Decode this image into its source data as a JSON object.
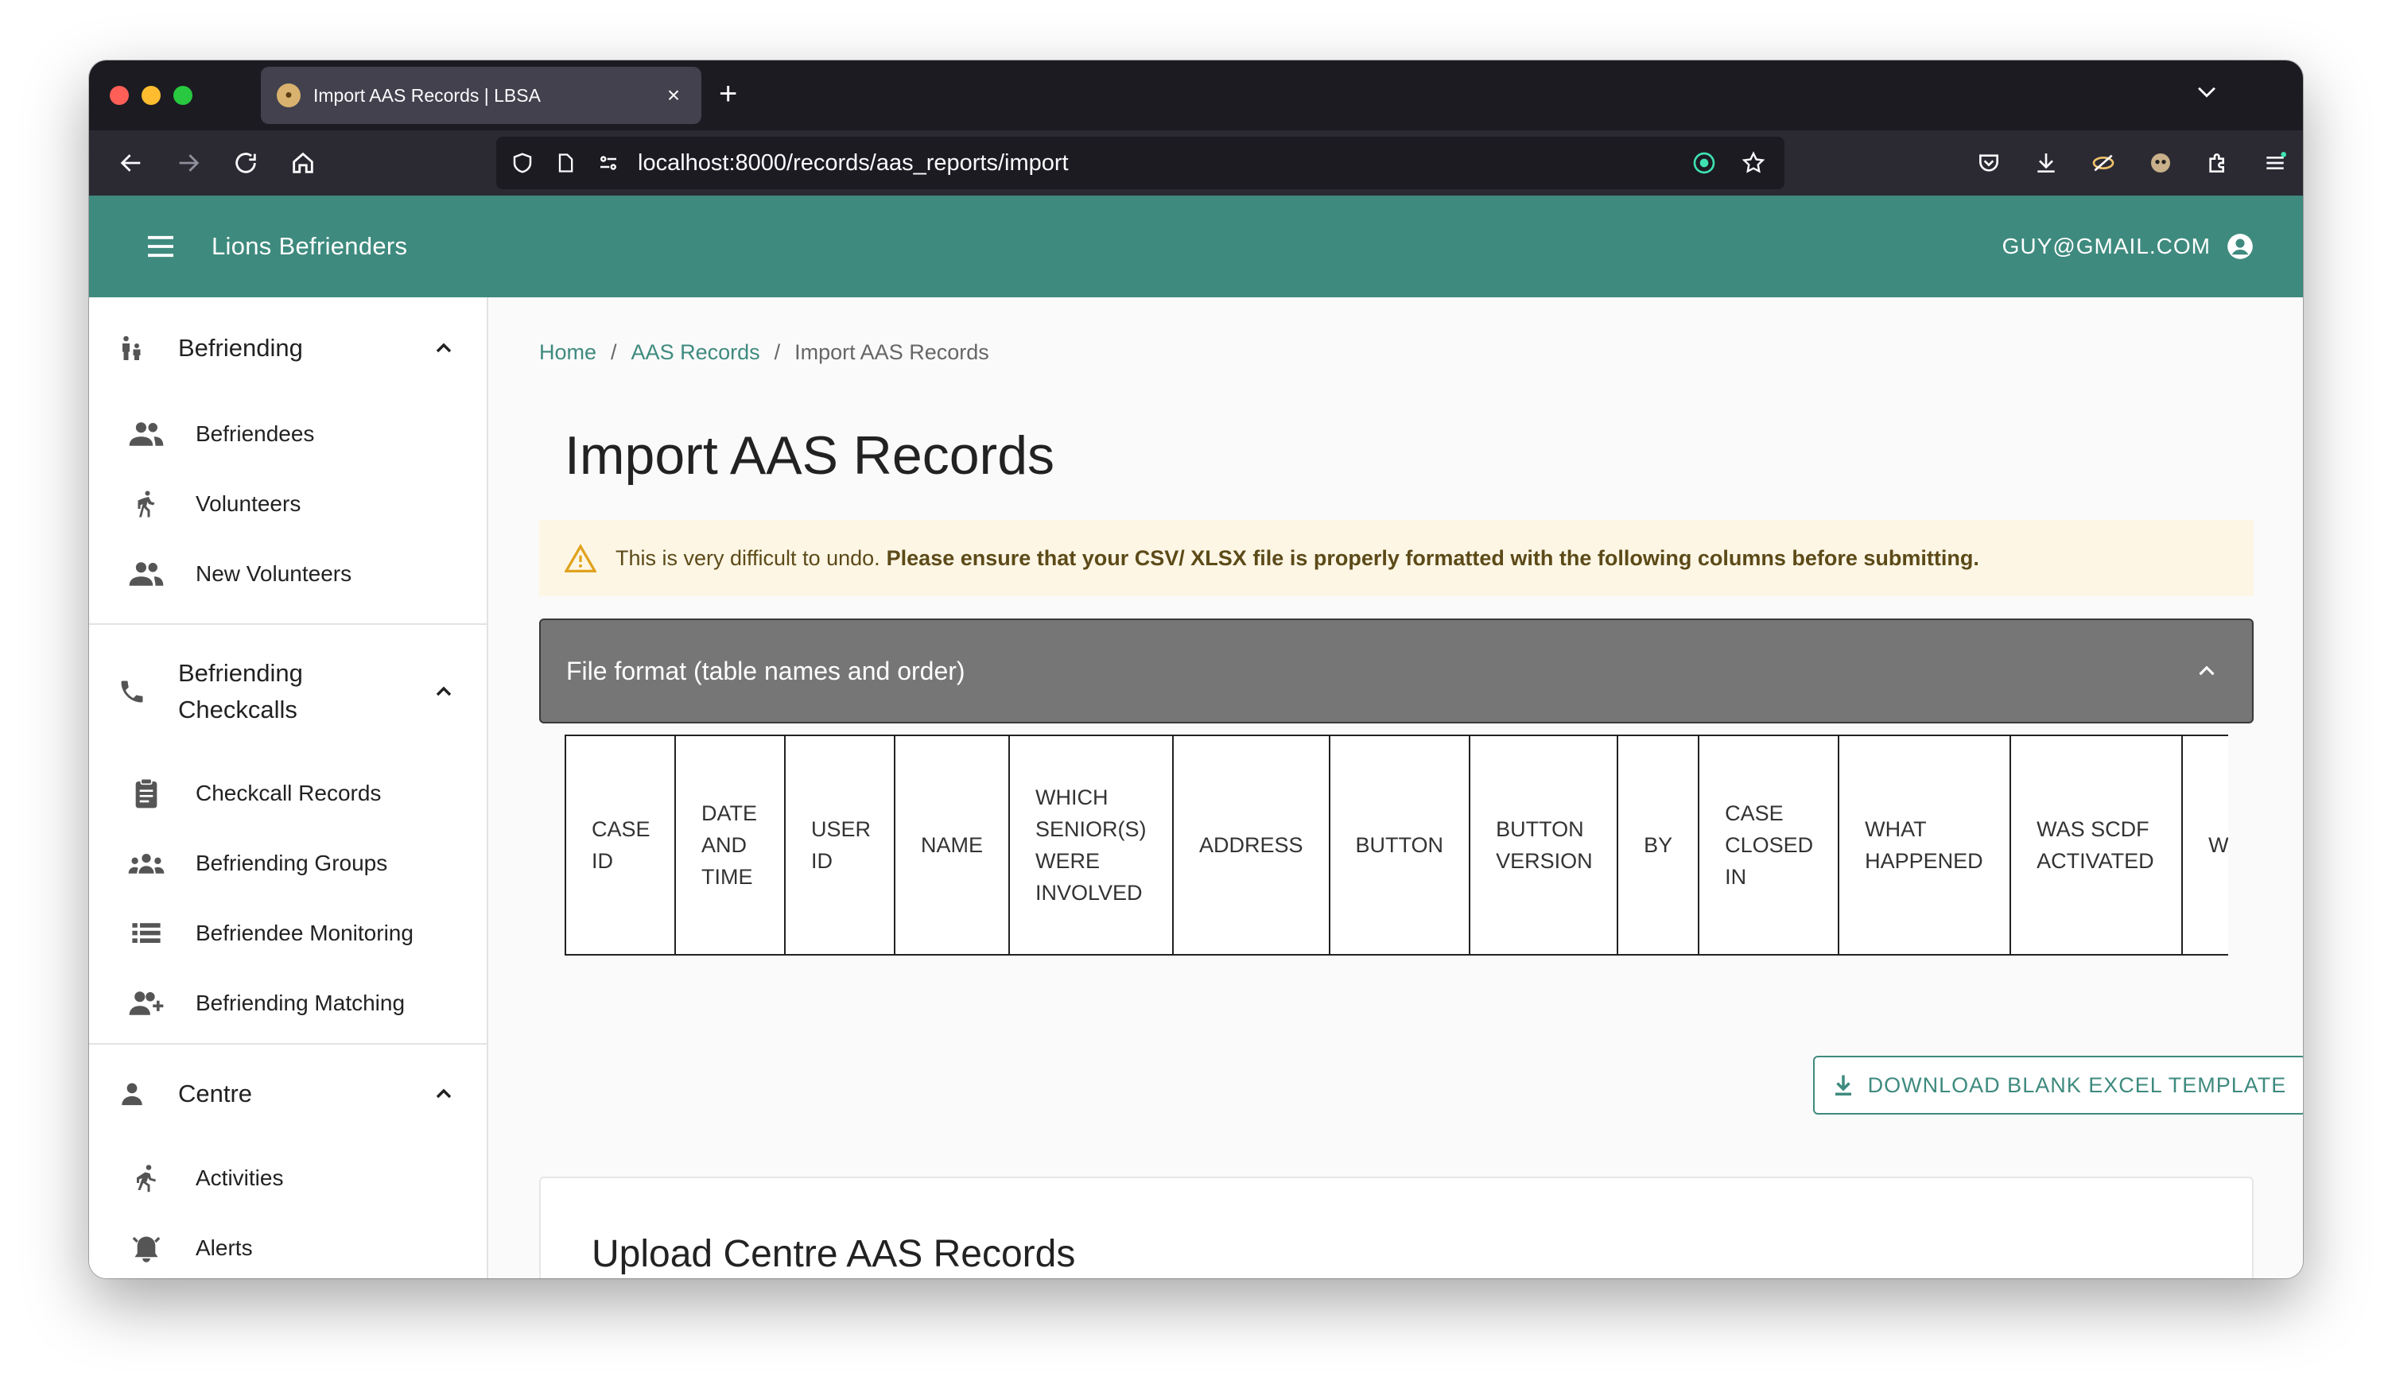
{
  "browser": {
    "tab_title": "Import AAS Records | LBSA",
    "url": "localhost:8000/records/aas_reports/import"
  },
  "app": {
    "title": "Lions Befrienders",
    "user_email": "GUY@GMAIL.COM",
    "brand_color": "#3e8a7e"
  },
  "sidebar": {
    "groups": [
      {
        "label": "Befriending",
        "icon": "family-icon",
        "items": [
          {
            "label": "Befriendees",
            "icon": "people-icon"
          },
          {
            "label": "Volunteers",
            "icon": "walking-person-icon"
          },
          {
            "label": "New Volunteers",
            "icon": "people-icon"
          }
        ]
      },
      {
        "label": "Befriending Checkcalls",
        "icon": "phone-icon",
        "items": [
          {
            "label": "Checkcall Records",
            "icon": "clipboard-icon"
          },
          {
            "label": "Befriending Groups",
            "icon": "groups-icon"
          },
          {
            "label": "Befriendee Monitoring",
            "icon": "list-icon"
          },
          {
            "label": "Befriending Matching",
            "icon": "person-add-icon"
          }
        ]
      },
      {
        "label": "Centre",
        "icon": "person-icon",
        "items": [
          {
            "label": "Activities",
            "icon": "running-icon"
          },
          {
            "label": "Alerts",
            "icon": "alarm-icon"
          }
        ]
      }
    ]
  },
  "breadcrumb": {
    "home": "Home",
    "parent": "AAS Records",
    "current": "Import AAS Records",
    "separator": "/"
  },
  "page": {
    "title": "Import AAS Records"
  },
  "alert": {
    "text": "This is very difficult to undo.",
    "bold_text": "Please ensure that your CSV/ XLSX file is properly formatted with the following columns before submitting."
  },
  "accordion": {
    "label": "File format (table names and order)"
  },
  "columns": [
    "CASE ID",
    "DATE AND TIME",
    "USER ID",
    "NAME",
    "WHICH SENIOR(S) WERE INVOLVED",
    "ADDRESS",
    "BUTTON",
    "BUTTON VERSION",
    "BY",
    "CASE CLOSED IN",
    "WHAT HAPPENED",
    "WAS SCDF ACTIVATED",
    "WAS ACTI"
  ],
  "download_button": {
    "label": "DOWNLOAD BLANK EXCEL TEMPLATE"
  },
  "upload": {
    "title": "Upload Centre AAS Records"
  }
}
